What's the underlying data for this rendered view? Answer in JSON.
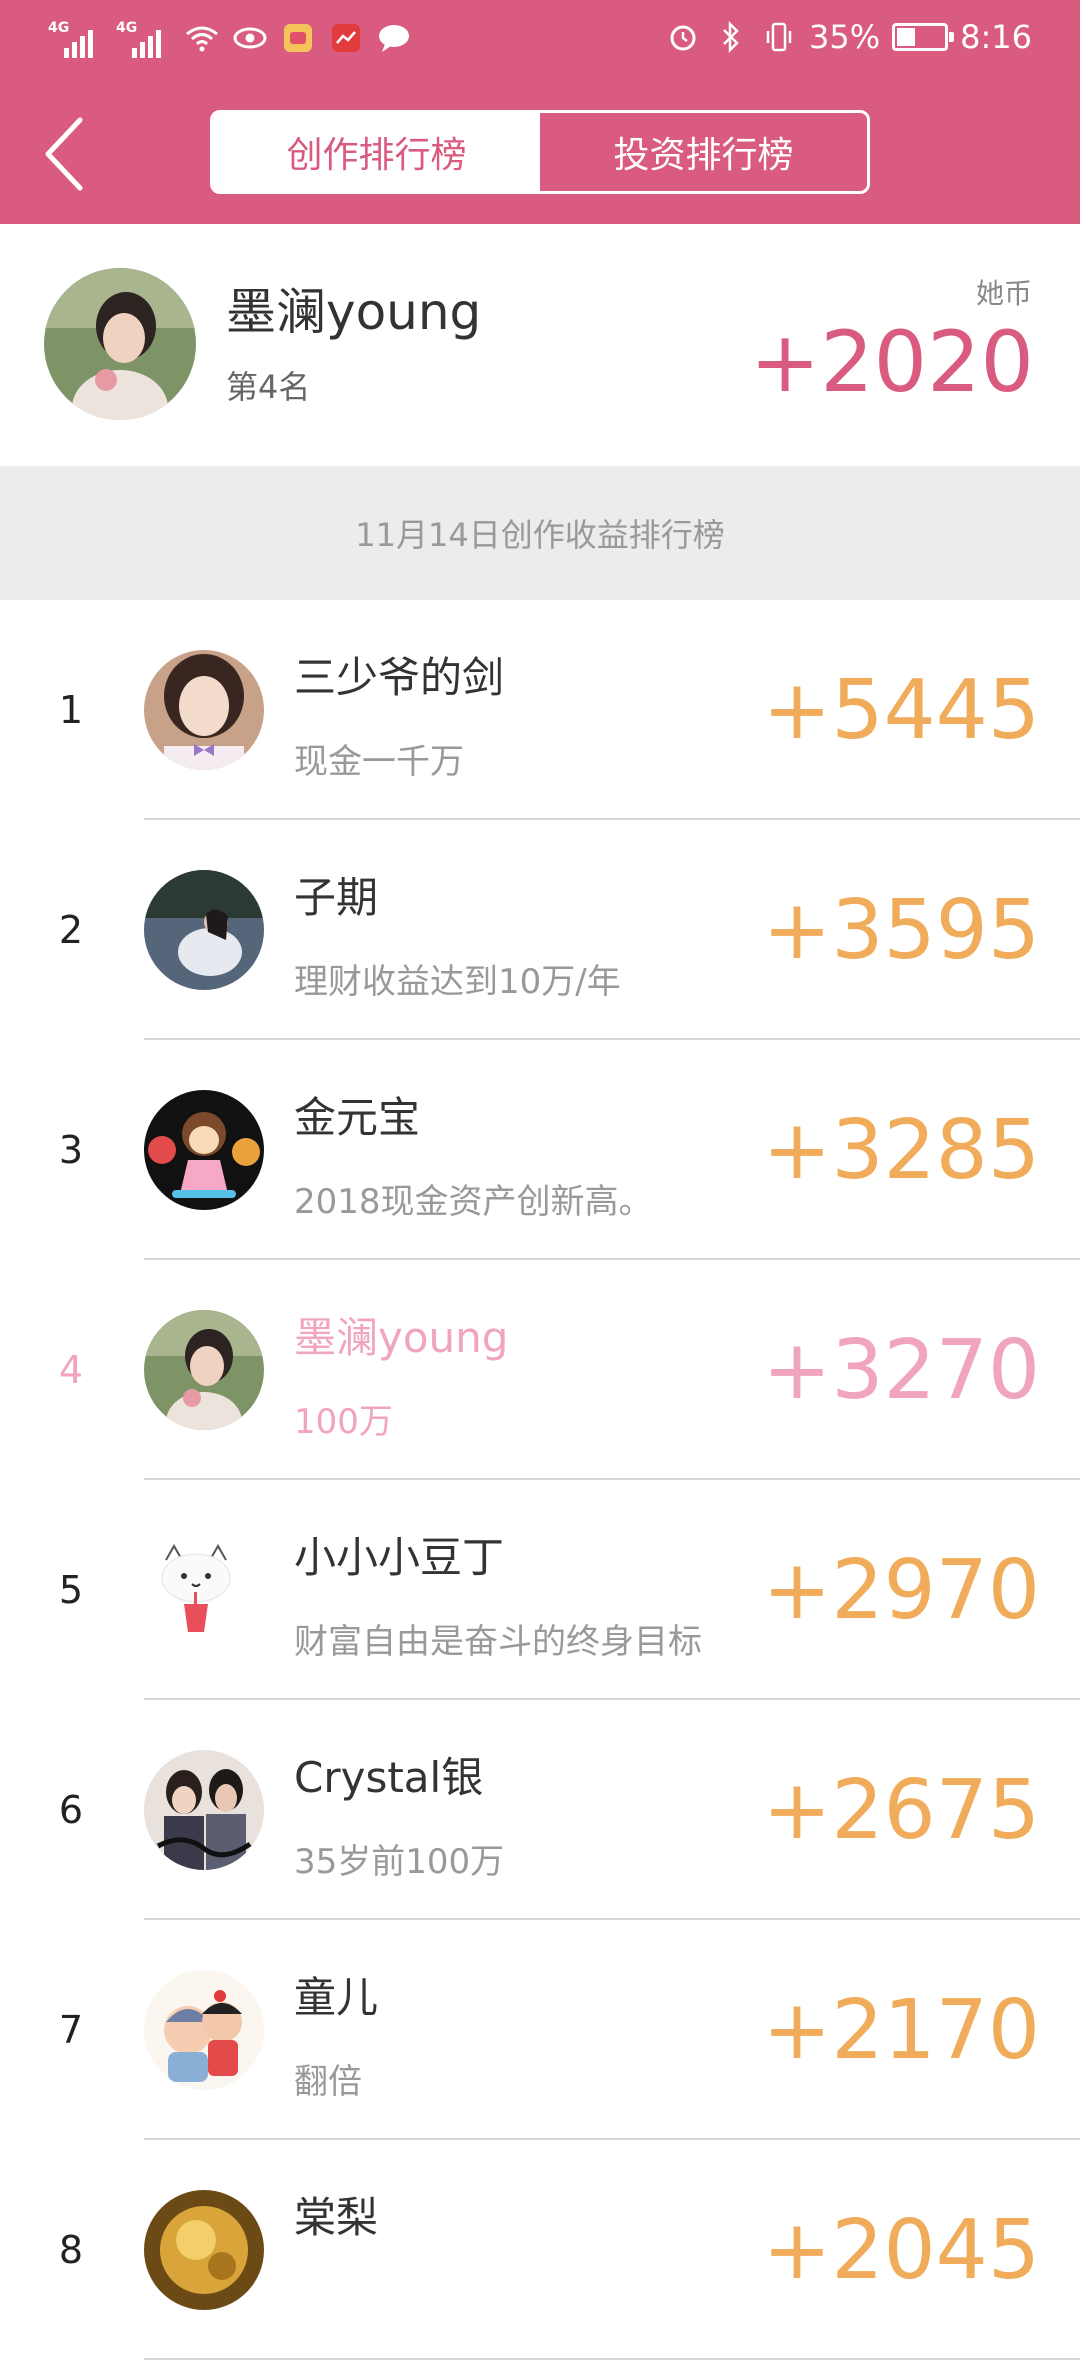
{
  "status_bar": {
    "network_1": "4G",
    "network_2": "4G",
    "battery": "35%",
    "time": "8:16"
  },
  "nav": {
    "tabs": [
      {
        "label": "创作排行榜",
        "active": true
      },
      {
        "label": "投资排行榜",
        "active": false
      }
    ]
  },
  "me": {
    "name": "墨澜young",
    "rank_text": "第4名",
    "currency_label": "她币",
    "score": "+2020"
  },
  "section_title": "11月14日创作收益排行榜",
  "colors": {
    "brand": "#d95b80",
    "score": "#f0ac5a",
    "highlight": "#f0a4bd"
  },
  "leaderboard": [
    {
      "rank": "1",
      "name": "三少爷的剑",
      "desc": "现金一千万",
      "score": "+5445"
    },
    {
      "rank": "2",
      "name": "子期",
      "desc": "理财收益达到10万/年",
      "score": "+3595"
    },
    {
      "rank": "3",
      "name": "金元宝",
      "desc": "2018现金资产创新高。",
      "score": "+3285"
    },
    {
      "rank": "4",
      "name": "墨澜young",
      "desc": "100万",
      "score": "+3270",
      "is_me": true
    },
    {
      "rank": "5",
      "name": "小小小豆丁",
      "desc": "财富自由是奋斗的终身目标",
      "score": "+2970"
    },
    {
      "rank": "6",
      "name": "Crystal银",
      "desc": "35岁前100万",
      "score": "+2675"
    },
    {
      "rank": "7",
      "name": "童儿",
      "desc": "翻倍",
      "score": "+2170"
    },
    {
      "rank": "8",
      "name": "棠梨",
      "desc": "",
      "score": "+2045"
    }
  ]
}
